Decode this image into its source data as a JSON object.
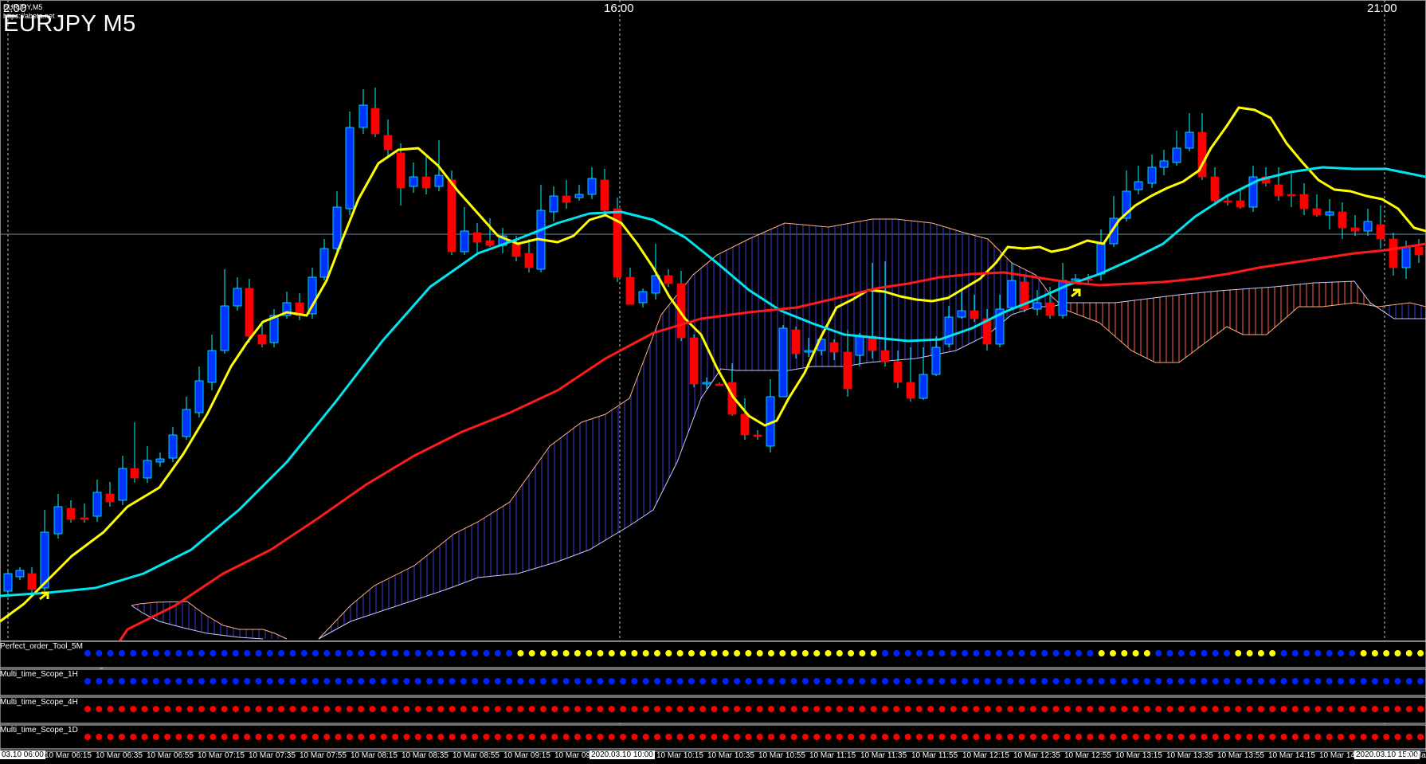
{
  "window": {
    "symbol_title": "EURJPY M5",
    "subtitle_1": "EURJPY,M5",
    "subtitle_2": "https://abeta.net"
  },
  "top_time_labels": [
    "2:00",
    "16:00",
    "21:00"
  ],
  "indicator_panels": [
    {
      "name": "Perfect_order_Tool_5M"
    },
    {
      "name": "Multi_time_Scope_1H"
    },
    {
      "name": "Multi_time_Scope_4H"
    },
    {
      "name": "Multi_time_Scope_1D"
    }
  ],
  "bottom_time_labels": [
    "03.10 06:00",
    "10 Mar 06:15",
    "10 Mar 06:35",
    "10 Mar 06:55",
    "10 Mar 07:15",
    "10 Mar 07:35",
    "10 Mar 07:55",
    "10 Mar 08:15",
    "10 Mar 08:35",
    "10 Mar 08:55",
    "10 Mar 09:15",
    "10 Mar 09:",
    "2020.03.10 10:00",
    "10 Mar 10:15",
    "10 Mar 10:35",
    "10 Mar 10:55",
    "10 Mar 11:15",
    "10 Mar 11:35",
    "10 Mar 11:55",
    "10 Mar 12:15",
    "10 Mar 12:35",
    "10 Mar 12:55",
    "10 Mar 13:15",
    "10 Mar 13:35",
    "10 Mar 13:55",
    "10 Mar 14:15",
    "10 Mar 14:",
    "2020.03.10 15:00",
    "10 Mar"
  ],
  "colors": {
    "background": "#000000",
    "bull_candle": "#0033ff",
    "bear_candle": "#ff0000",
    "wick": "#00ffff",
    "fast_ma": "#ffff00",
    "mid_ma": "#00e5ee",
    "slow_ma": "#ff1a1a",
    "cloud_bull": "#3b3bd9",
    "cloud_bear": "#ff6a40",
    "dot_blue": "#0022ff",
    "dot_yellow": "#ffff00",
    "dot_red": "#ff0000",
    "grid": "#c0c0c0"
  }
}
